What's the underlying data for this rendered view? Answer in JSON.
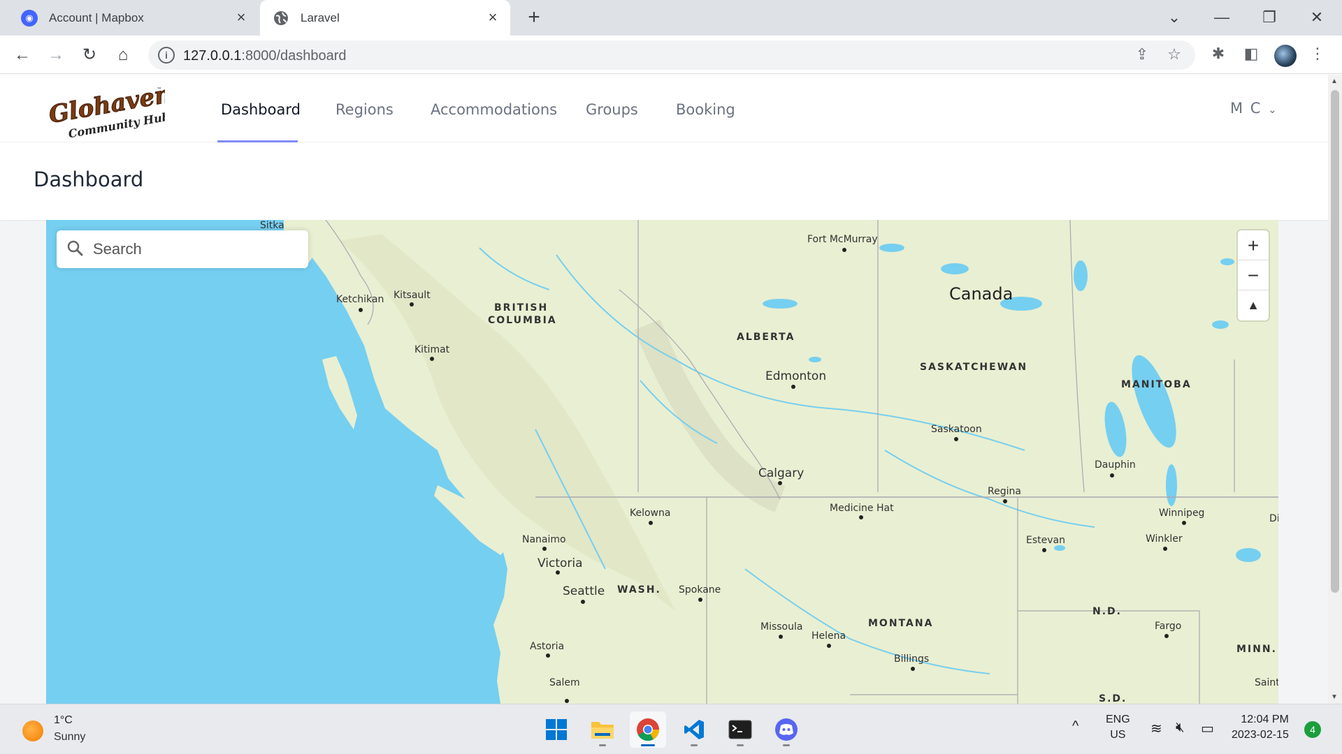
{
  "browser": {
    "tabs": [
      {
        "title": "Account | Mapbox",
        "active": false
      },
      {
        "title": "Laravel",
        "active": true
      }
    ],
    "url_host": "127.0.0.1",
    "url_path": ":8000/dashboard"
  },
  "app": {
    "logo_text_main": "Glohaven",
    "logo_text_sub": "Community Hub",
    "logo_tm": "™",
    "nav": [
      {
        "label": "Dashboard",
        "active": true
      },
      {
        "label": "Regions",
        "active": false
      },
      {
        "label": "Accommodations",
        "active": false
      },
      {
        "label": "Groups",
        "active": false
      },
      {
        "label": "Booking",
        "active": false
      }
    ],
    "user_initials": "M C",
    "page_title": "Dashboard"
  },
  "map": {
    "search_placeholder": "Search",
    "controls": {
      "zoom_in": "+",
      "zoom_out": "−",
      "compass": "▲"
    },
    "country_label": "Canada",
    "regions": [
      {
        "name": "BRITISH",
        "line2": "COLUMBIA"
      },
      {
        "name": "ALBERTA"
      },
      {
        "name": "SASKATCHEWAN"
      },
      {
        "name": "MANITOBA"
      },
      {
        "name": "WASH."
      },
      {
        "name": "MONTANA"
      },
      {
        "name": "N.D."
      },
      {
        "name": "MINN."
      },
      {
        "name": "S.D."
      }
    ],
    "cities": [
      "Sitka",
      "Fort McMurray",
      "Ketchikan",
      "Kitsault",
      "Kitimat",
      "Edmonton",
      "Saskatoon",
      "Calgary",
      "Dauphin",
      "Regina",
      "Medicine Hat",
      "Kelowna",
      "Winnipeg",
      "Nanaimo",
      "Estevan",
      "Winkler",
      "Victoria",
      "Seattle",
      "Spokane",
      "Missoula",
      "Helena",
      "Fargo",
      "Astoria",
      "Billings",
      "Salem",
      "Di",
      "Saint"
    ]
  },
  "taskbar": {
    "weather_temp": "1°C",
    "weather_cond": "Sunny",
    "lang_line1": "ENG",
    "lang_line2": "US",
    "time": "12:04 PM",
    "date": "2023-02-15",
    "notifications": "4"
  },
  "colors": {
    "water": "#75cff0",
    "land": "#e9efd2",
    "nav_active_underline": "#818cf8",
    "taskbar": "#e8eaee"
  }
}
